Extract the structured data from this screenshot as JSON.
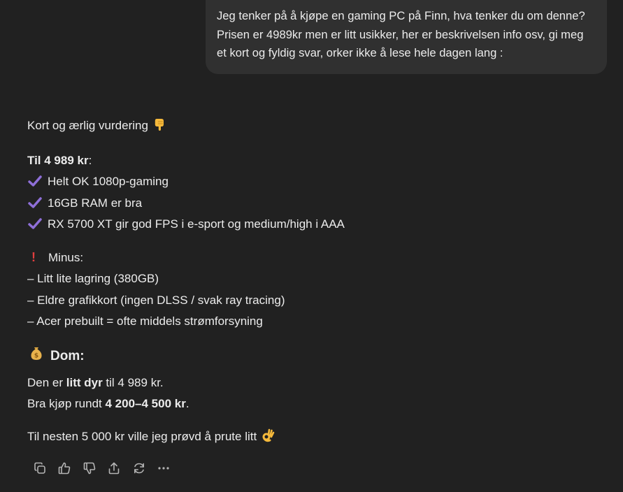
{
  "user_message": {
    "lines": [
      "Jeg tenker på å kjøpe en gaming PC på Finn, hva tenker du om denne?",
      "Prisen er 4989kr men er litt usikker, her er beskrivelsen info osv, gi meg",
      "et kort og fyldig svar, orker ikke å lese hele dagen lang :"
    ]
  },
  "assistant": {
    "intro": "Kort og ærlig vurdering",
    "intro_emoji": "point-down-emoji",
    "pros_heading": "Til 4 989 kr",
    "pros_heading_suffix": ":",
    "pros": [
      "Helt OK 1080p-gaming",
      "16GB RAM er bra",
      "RX 5700 XT gir god FPS i e-sport og medium/high i AAA"
    ],
    "cons_mark": "!",
    "cons_heading": "Minus:",
    "cons": [
      "– Litt lite lagring (380GB)",
      "– Eldre grafikkort (ingen DLSS / svak ray tracing)",
      "– Acer prebuilt = ofte middels strømforsyning"
    ],
    "verdict_heading": "Dom:",
    "verdict_line1": {
      "pre": "Den er ",
      "bold": "litt dyr",
      "post": " til 4 989 kr."
    },
    "verdict_line2": {
      "pre": "Bra kjøp rundt ",
      "bold": "4 200–4 500 kr",
      "post": "."
    },
    "closing": "Til nesten 5 000 kr ville jeg prøvd å prute litt",
    "closing_emoji": "ok-hand-emoji"
  },
  "actions": {
    "copy": "copy-icon",
    "like": "thumbs-up-icon",
    "dislike": "thumbs-down-icon",
    "share": "share-icon",
    "regenerate": "regenerate-icon",
    "more": "more-icon"
  },
  "colors": {
    "background": "#212121",
    "bubble": "#303030",
    "text": "#ececec",
    "check": "#8e6fd8",
    "exclamation": "#e03e3e",
    "icon": "#b4b4b4"
  }
}
